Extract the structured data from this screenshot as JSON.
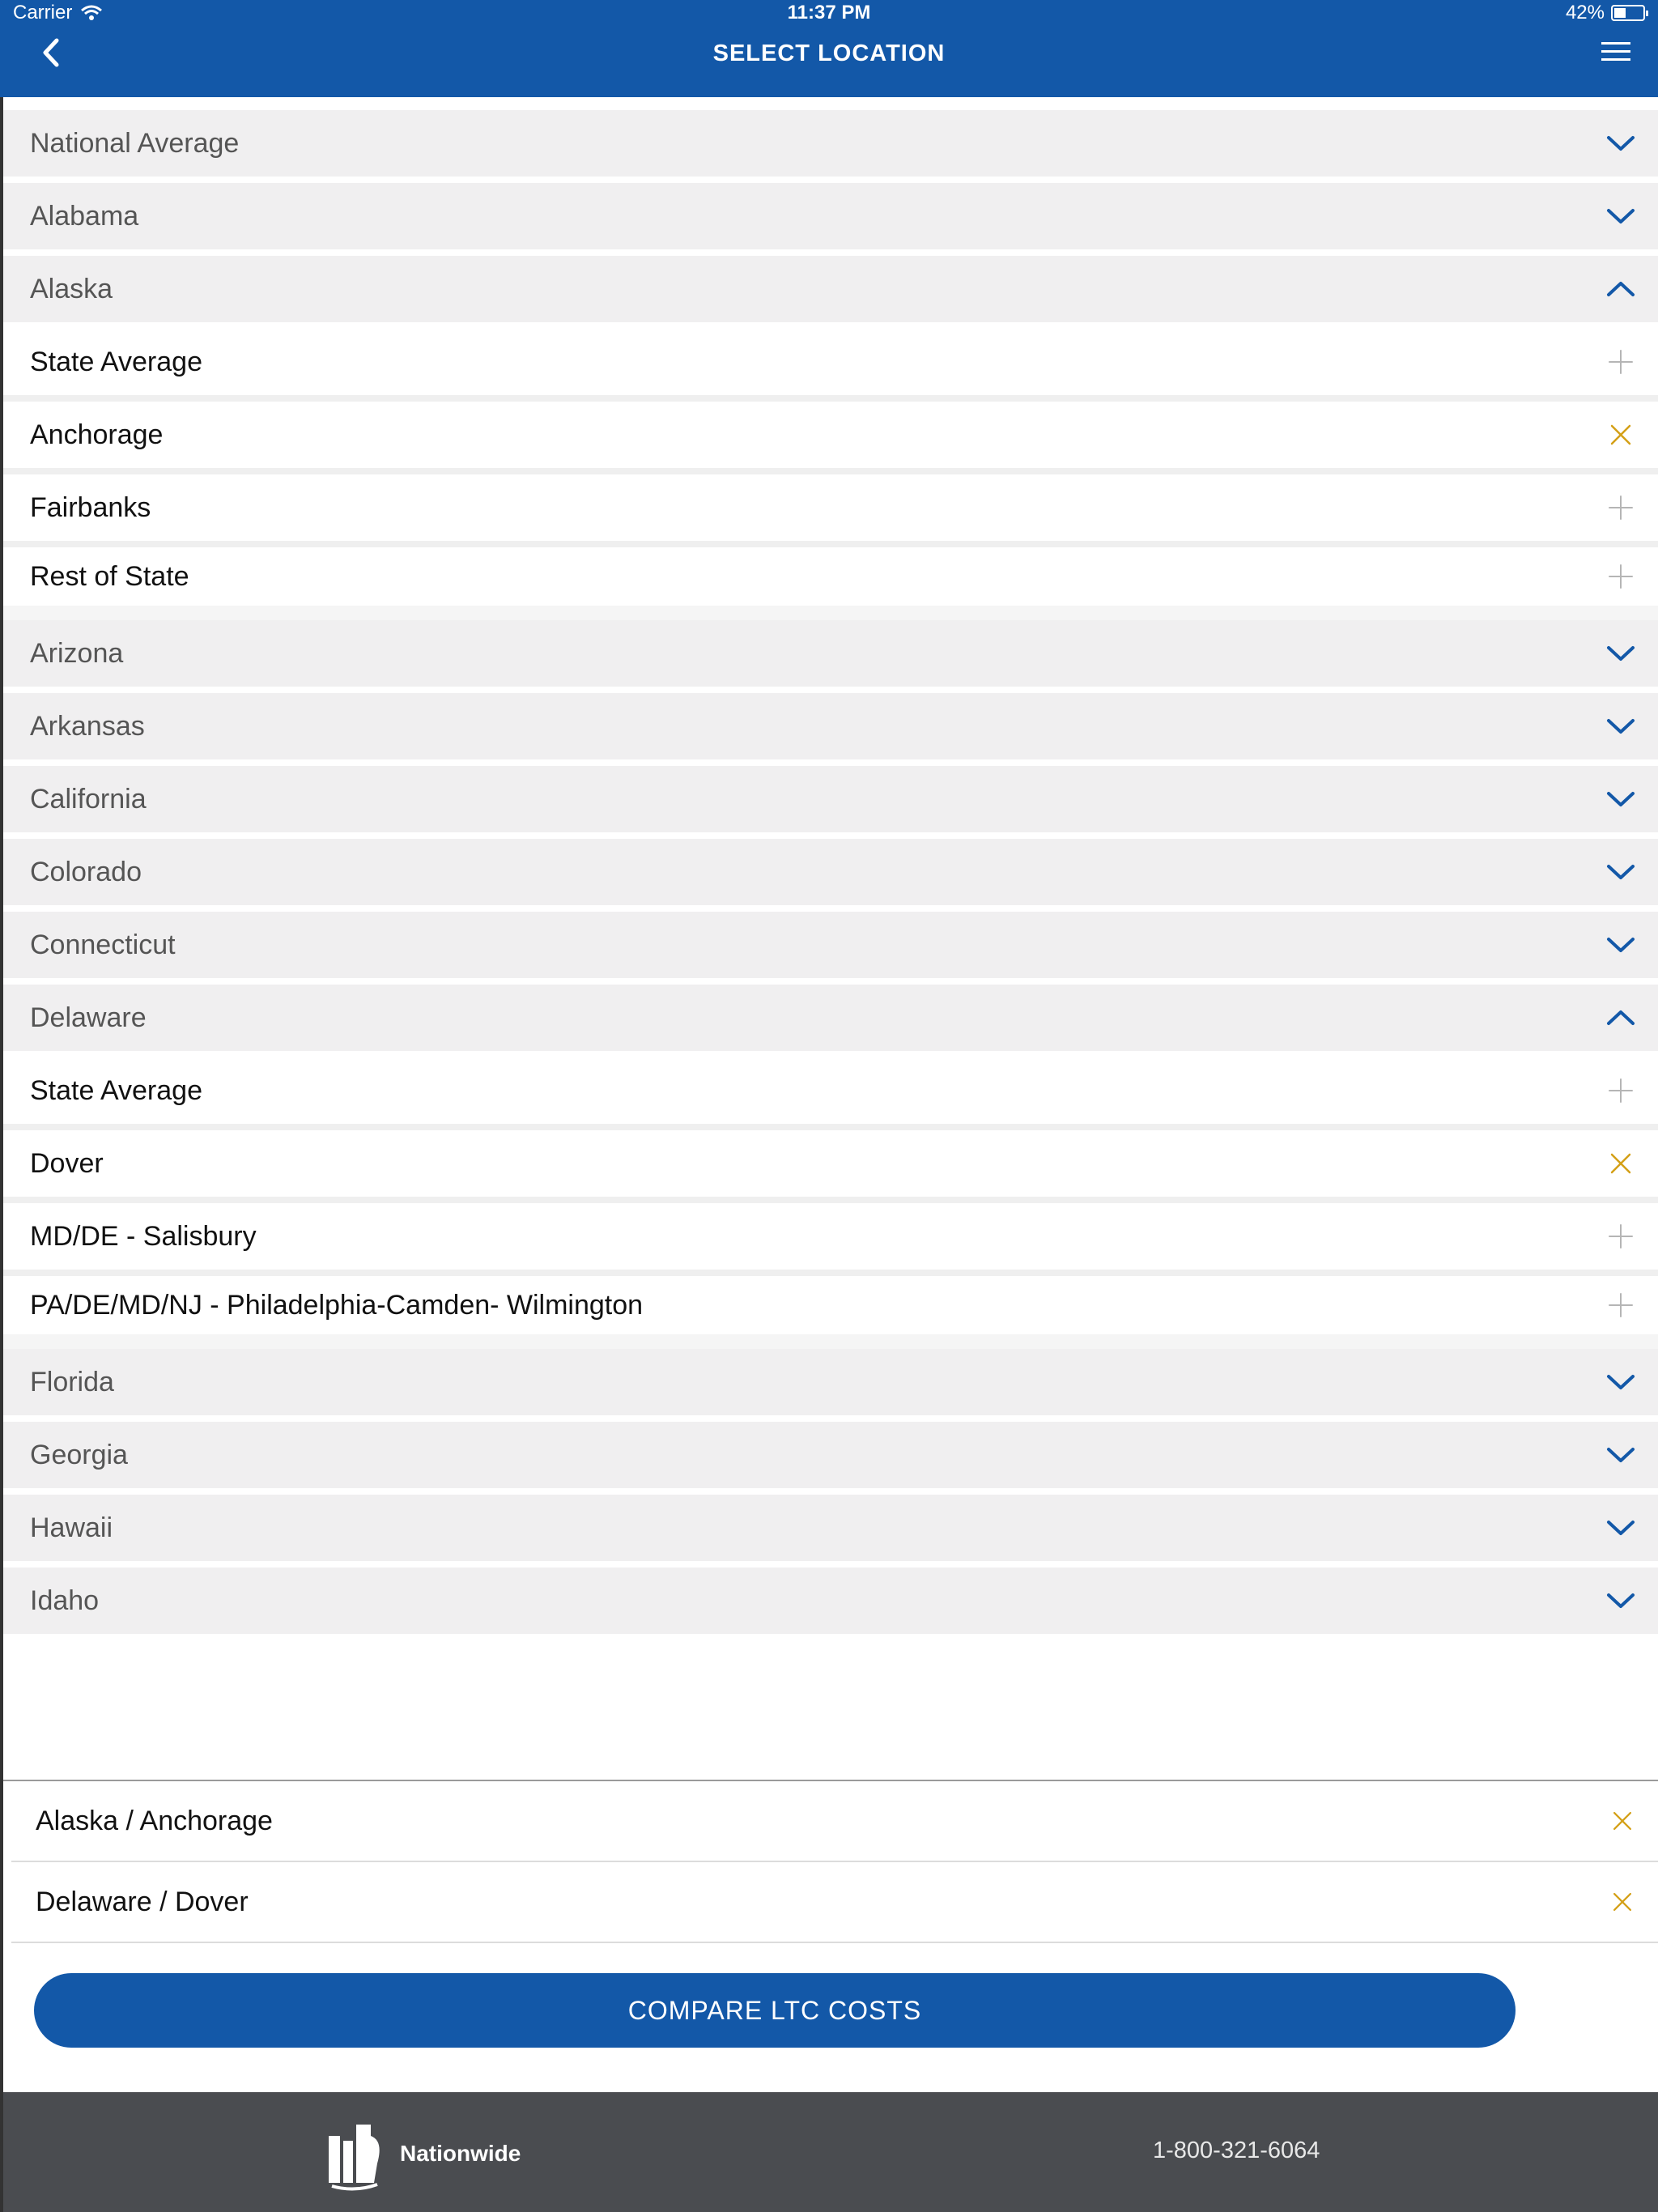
{
  "status_bar": {
    "carrier": "Carrier",
    "time": "11:37 PM",
    "battery": "42%"
  },
  "header": {
    "title": "SELECT LOCATION"
  },
  "colors": {
    "brand_blue": "#1358a8",
    "remove_gold": "#d4a017",
    "footer_gray": "#4a4c50"
  },
  "locations": [
    {
      "label": "National Average",
      "type": "state",
      "icon": "chevron-down-icon"
    },
    {
      "label": "Alabama",
      "type": "state",
      "icon": "chevron-down-icon"
    },
    {
      "label": "Alaska",
      "type": "state",
      "icon": "chevron-up-icon"
    },
    {
      "label": "State Average",
      "type": "sub",
      "icon": "plus-icon"
    },
    {
      "label": "Anchorage",
      "type": "sub",
      "icon": "close-icon"
    },
    {
      "label": "Fairbanks",
      "type": "sub",
      "icon": "plus-icon"
    },
    {
      "label": "Rest of State",
      "type": "sub",
      "icon": "plus-icon"
    },
    {
      "label": "Arizona",
      "type": "state",
      "icon": "chevron-down-icon"
    },
    {
      "label": "Arkansas",
      "type": "state",
      "icon": "chevron-down-icon"
    },
    {
      "label": "California",
      "type": "state",
      "icon": "chevron-down-icon"
    },
    {
      "label": "Colorado",
      "type": "state",
      "icon": "chevron-down-icon"
    },
    {
      "label": "Connecticut",
      "type": "state",
      "icon": "chevron-down-icon"
    },
    {
      "label": "Delaware",
      "type": "state",
      "icon": "chevron-up-icon"
    },
    {
      "label": "State Average",
      "type": "sub",
      "icon": "plus-icon"
    },
    {
      "label": "Dover",
      "type": "sub",
      "icon": "close-icon"
    },
    {
      "label": "MD/DE - Salisbury",
      "type": "sub",
      "icon": "plus-icon"
    },
    {
      "label": "PA/DE/MD/NJ - Philadelphia-Camden- Wilmington",
      "type": "sub",
      "icon": "plus-icon"
    },
    {
      "label": "Florida",
      "type": "state",
      "icon": "chevron-down-icon"
    },
    {
      "label": "Georgia",
      "type": "state",
      "icon": "chevron-down-icon"
    },
    {
      "label": "Hawaii",
      "type": "state",
      "icon": "chevron-down-icon"
    },
    {
      "label": "Idaho",
      "type": "state",
      "icon": "chevron-down-icon"
    }
  ],
  "selected": [
    {
      "label": "Alaska / Anchorage",
      "icon": "close-icon"
    },
    {
      "label": "Delaware / Dover",
      "icon": "close-icon"
    }
  ],
  "cta": {
    "label": "COMPARE LTC COSTS"
  },
  "footer": {
    "brand": "Nationwide",
    "phone": "1-800-321-6064"
  }
}
